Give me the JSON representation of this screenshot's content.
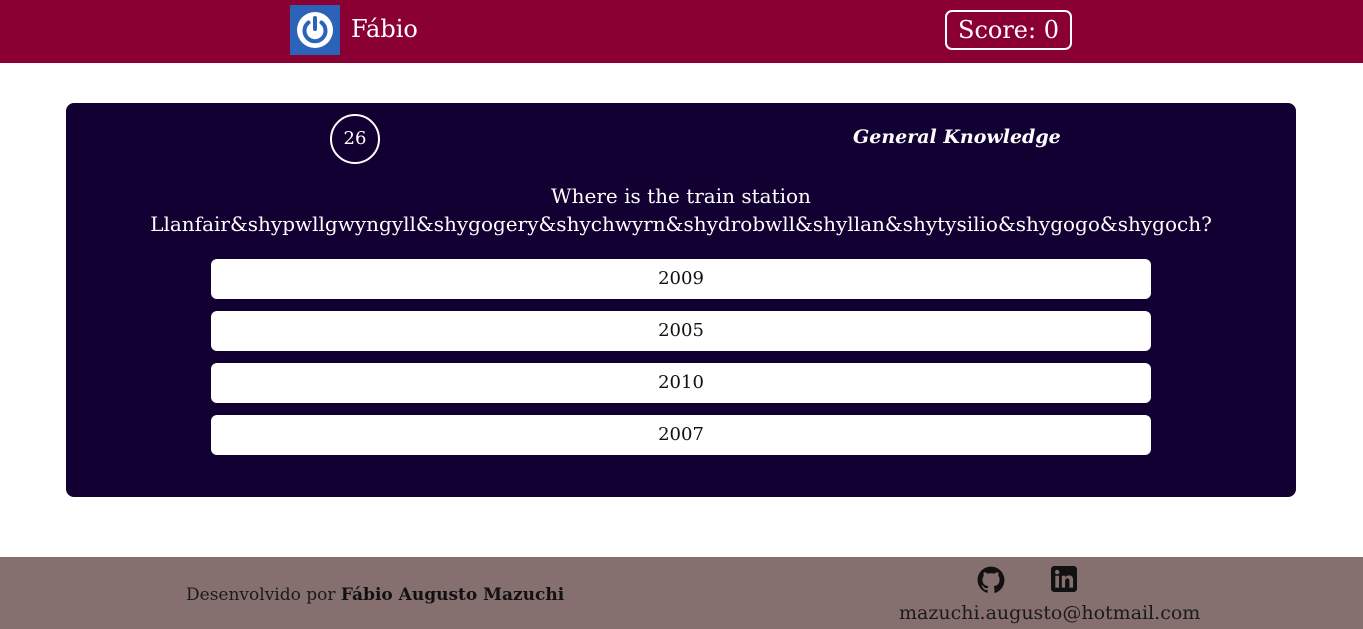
{
  "header": {
    "username": "Fábio",
    "score_text": "Score: 0",
    "brand_color": "#8b0032",
    "avatar_icon": "power-icon"
  },
  "quiz": {
    "timer": "26",
    "category": "General Knowledge",
    "question_line1": "Where is the train station",
    "question_line2": "Llanfair&shypwllgwyngyll&shygogery&shychwyrn&shydrobwll&shyllan&shytysilio&shygogo&shygoch?",
    "answers": [
      "2009",
      "2005",
      "2010",
      "2007"
    ],
    "panel_color": "#120032"
  },
  "footer": {
    "credit_prefix": "Desenvolvido por",
    "credit_name": "Fábio Augusto Mazuchi",
    "github_icon": "github-icon",
    "linkedin_icon": "linkedin-icon",
    "email": "mazuchi.augusto@hotmail.com",
    "footer_color": "#85706f"
  }
}
